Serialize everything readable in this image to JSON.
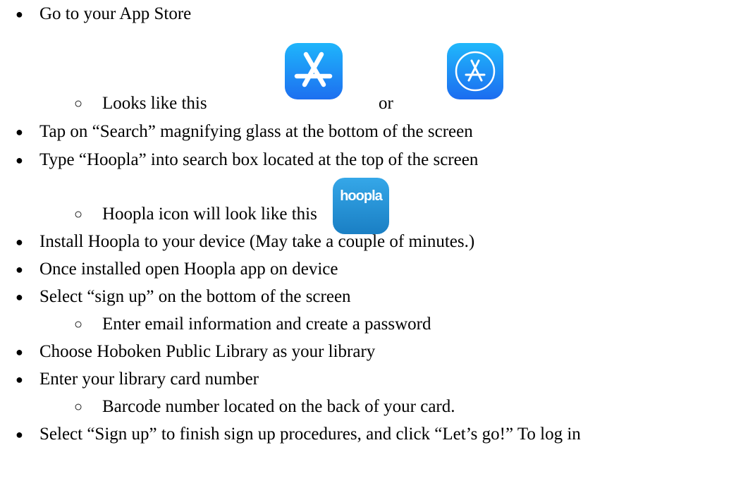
{
  "bullets": {
    "filled": "●",
    "hollow": "○"
  },
  "steps": [
    {
      "text": "Go to your App Store"
    },
    {
      "text": "Looks like this"
    },
    {
      "text": "or"
    },
    {
      "text": "Tap on “Search” magnifying glass at the bottom of the screen"
    },
    {
      "text": "Type “Hoopla” into search box located at the top of the screen"
    },
    {
      "text": "Hoopla icon will look like this"
    },
    {
      "text": "Install Hoopla to your device (May take a couple of minutes.)"
    },
    {
      "text": "Once installed open Hoopla app on device"
    },
    {
      "text": "Select “sign up” on the bottom of the screen"
    },
    {
      "text": "Enter email information and create a password"
    },
    {
      "text": "Choose Hoboken Public Library as your library"
    },
    {
      "text": "Enter your library card number"
    },
    {
      "text": "Barcode number located on the back of your card."
    },
    {
      "text": "Select “Sign up” to finish sign up procedures, and click “Let’s go!” To log in"
    }
  ],
  "icons": {
    "app_store_new": "app-store-icon",
    "app_store_old": "app-store-legacy-icon",
    "hoopla": "hoopla-app-icon",
    "hoopla_label": "hoopla"
  },
  "colors": {
    "app_store_blue_top": "#1fb5fb",
    "app_store_blue_bottom": "#1d6ff0",
    "hoopla_blue_top": "#35a7e8",
    "hoopla_blue_bottom": "#1a7fc4",
    "text": "#000000"
  }
}
